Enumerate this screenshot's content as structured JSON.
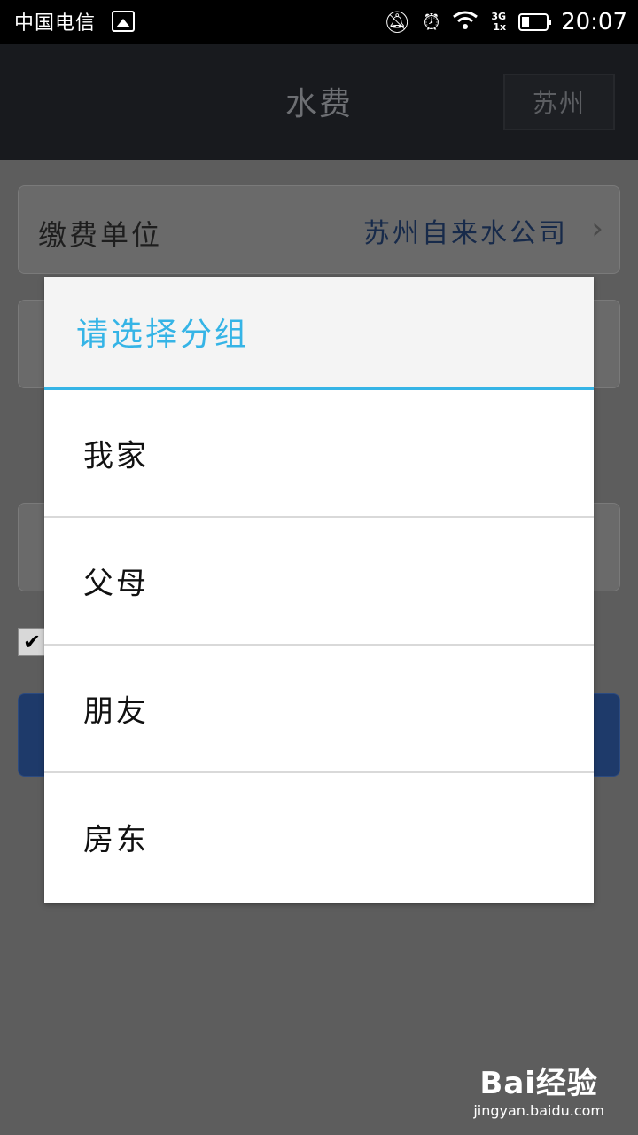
{
  "status_bar": {
    "carrier": "中国电信",
    "network_top": "3G",
    "network_bottom": "1x",
    "time": "20:07",
    "icons": [
      "picture-icon",
      "notifications-off-icon",
      "alarm-icon",
      "wifi-icon",
      "signal-icon",
      "battery-icon"
    ]
  },
  "app_bar": {
    "title": "水费",
    "city_button": "苏州"
  },
  "form": {
    "payment_unit_label": "缴费单位",
    "payment_unit_value": "苏州自来水公司"
  },
  "dialog": {
    "title": "请选择分组",
    "options": [
      "我家",
      "父母",
      "朋友",
      "房东"
    ]
  },
  "watermark": {
    "brand": "Bai经验",
    "url": "jingyan.baidu.com"
  },
  "colors": {
    "accent": "#35b4e6",
    "app_bar": "#181a1e",
    "overlay": "#5d5d5d",
    "primary_button": "#1e3a6a"
  }
}
